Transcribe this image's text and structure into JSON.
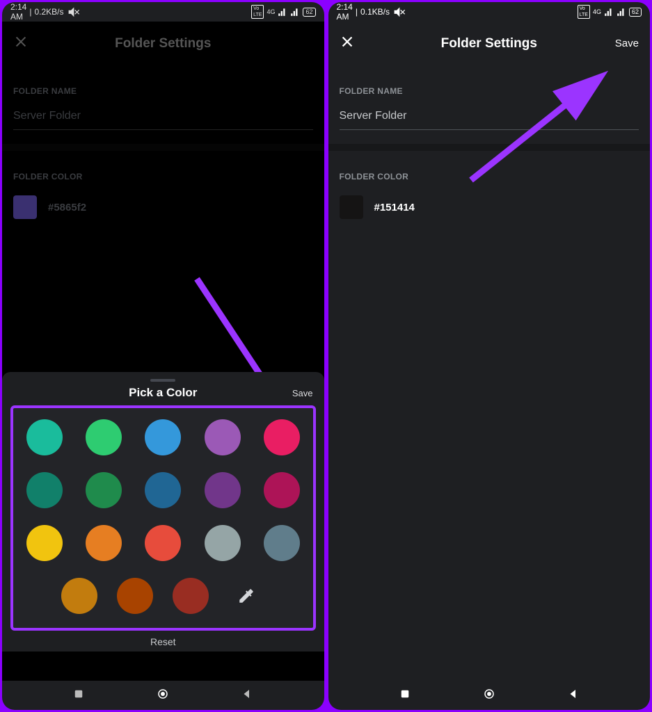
{
  "left": {
    "status": {
      "time": "2:14 AM",
      "net": "0.2KB/s",
      "battery": "62",
      "g": "4G"
    },
    "header": {
      "title": "Folder Settings"
    },
    "labels": {
      "folder_name": "FOLDER NAME",
      "folder_color": "FOLDER COLOR"
    },
    "folder_name_value": "Server Folder",
    "color": {
      "hex": "#5865f2",
      "swatch": "#3a3070"
    },
    "sheet": {
      "title": "Pick a Color",
      "save": "Save",
      "reset": "Reset",
      "colors_row1": [
        "#1abc9c",
        "#2ecc71",
        "#3498db",
        "#9b59b6",
        "#e91e63"
      ],
      "colors_row2": [
        "#11806a",
        "#1f8b4c",
        "#206694",
        "#71368a",
        "#ad1457"
      ],
      "colors_row3": [
        "#f1c40f",
        "#e67e22",
        "#e74c3c",
        "#95a5a6",
        "#607d8b"
      ],
      "colors_row4": [
        "#c27c0e",
        "#a84300",
        "#992d22"
      ]
    }
  },
  "right": {
    "status": {
      "time": "2:14 AM",
      "net": "0.1KB/s",
      "battery": "62",
      "g": "4G"
    },
    "header": {
      "title": "Folder Settings",
      "save": "Save"
    },
    "labels": {
      "folder_name": "FOLDER NAME",
      "folder_color": "FOLDER COLOR"
    },
    "folder_name_value": "Server Folder",
    "color": {
      "hex": "#151414",
      "swatch": "#151414"
    }
  }
}
